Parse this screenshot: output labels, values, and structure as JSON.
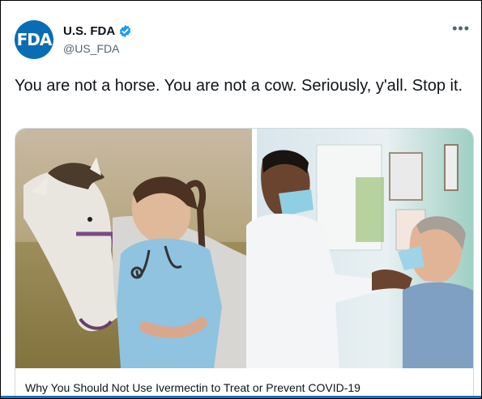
{
  "account": {
    "display_name": "U.S. FDA",
    "handle": "@US_FDA",
    "avatar_logo": "FDA",
    "verified": true,
    "verified_color": "#1d9bf0",
    "avatar_color": "#0a6db4"
  },
  "menu_icon": "more-horizontal-icon",
  "tweet": {
    "text": "You are not a horse. You are not a cow. Seriously, y'all. Stop it."
  },
  "card": {
    "title": "Why You Should Not Use Ivermectin to Treat or Prevent COVID-19"
  }
}
